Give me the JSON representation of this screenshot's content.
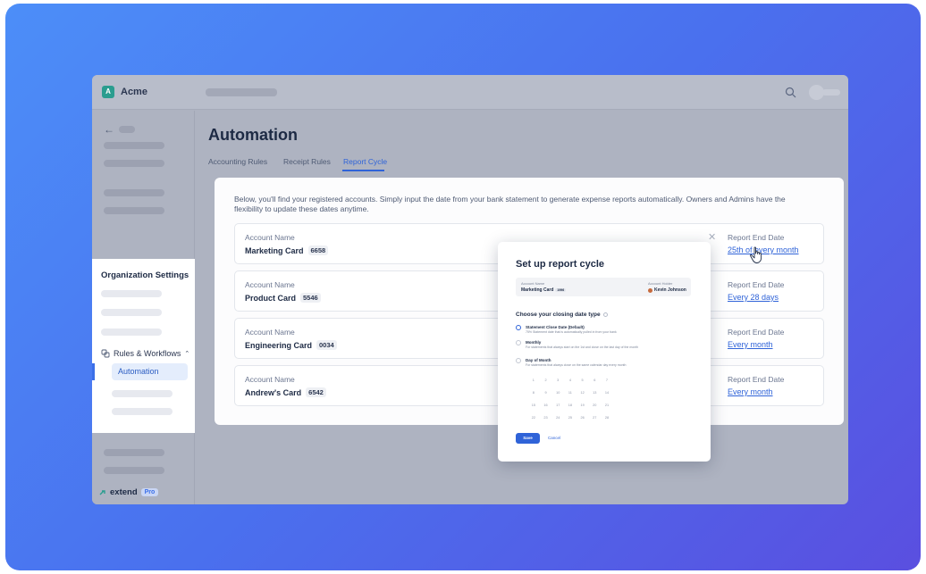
{
  "app": {
    "org_initial": "A",
    "org_name": "Acme",
    "brand": "extend",
    "brand_badge": "Pro"
  },
  "sidebar": {
    "org_settings_title": "Organization Settings",
    "rules_workflows": "Rules & Workflows",
    "automation": "Automation"
  },
  "main": {
    "title": "Automation",
    "tabs": [
      {
        "label": "Accounting Rules",
        "active": false
      },
      {
        "label": "Receipt Rules",
        "active": false
      },
      {
        "label": "Report Cycle",
        "active": true
      }
    ],
    "description": "Below, you'll find your registered accounts. Simply input the date from your bank statement to generate expense reports automatically. Owners and Admins have the flexibility to update these dates anytime.",
    "account_label": "Account Name",
    "end_label": "Report End Date",
    "accounts": [
      {
        "name": "Marketing Card",
        "number": "6658",
        "end": "25th of every month"
      },
      {
        "name": "Product Card",
        "number": "5546",
        "end": "Every 28 days"
      },
      {
        "name": "Engineering Card",
        "number": "0034",
        "end": "Every month"
      },
      {
        "name": "Andrew's Card",
        "number": "6542",
        "end": "Every month"
      }
    ]
  },
  "modal": {
    "title": "Set up report cycle",
    "account_name_label": "Account Name",
    "account_name": "Marketing Card",
    "account_number": "1996",
    "holder_label": "Account Holder",
    "holder_name": "Kevin Johnson",
    "choose_label": "Choose your closing date type",
    "options": [
      {
        "title": "Statement Close Date (Default)",
        "desc": "75% Statement date that is automatically pulled in from your bank",
        "selected": true
      },
      {
        "title": "Monthly",
        "desc": "For statements that always start on the 1st and close on the last day of the month",
        "selected": false
      },
      {
        "title": "Day of Month",
        "desc": "For statements that always close on the same calendar day every month",
        "selected": false
      }
    ],
    "calendar_rows": [
      [
        "1",
        "2",
        "3",
        "4",
        "5",
        "6",
        "7"
      ],
      [
        "8",
        "9",
        "10",
        "11",
        "12",
        "13",
        "14"
      ],
      [
        "15",
        "16",
        "17",
        "18",
        "19",
        "20",
        "21"
      ],
      [
        "22",
        "23",
        "24",
        "25",
        "26",
        "27",
        "28"
      ]
    ],
    "save_label": "Save",
    "cancel_label": "Cancel"
  },
  "colors": {
    "accent": "#2f63d8",
    "background_gradient_start": "#4c8ef8",
    "background_gradient_end": "#5a4fe0"
  }
}
